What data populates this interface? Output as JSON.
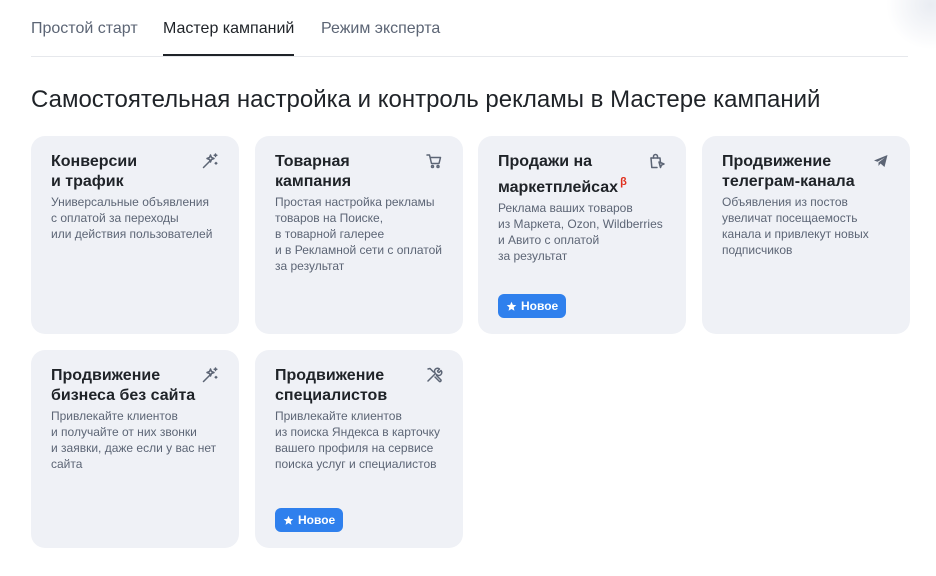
{
  "tabs": [
    {
      "label": "Простой старт",
      "active": false
    },
    {
      "label": "Мастер кампаний",
      "active": true
    },
    {
      "label": "Режим эксперта",
      "active": false
    }
  ],
  "page": {
    "title": "Самостоятельная настройка и контроль рекламы в Мастере кампаний"
  },
  "cards": [
    {
      "title_lines": [
        "Конверсии",
        "и трафик"
      ],
      "desc_lines": [
        "Универсальные объявления",
        "с оплатой за переходы",
        "или действия пользователей"
      ],
      "icon": "magic-wand-icon"
    },
    {
      "title_lines": [
        "Товарная",
        "кампания"
      ],
      "desc_lines": [
        "Простая настройка рекламы",
        "товаров на Поиске,",
        "в товарной галерее",
        "и в Рекламной сети с оплатой",
        "за результат"
      ],
      "icon": "cart-icon"
    },
    {
      "title_lines": [
        "Продажи на",
        "маркетплейсах"
      ],
      "beta": "β",
      "desc_lines": [
        "Реклама ваших товаров",
        "из Маркета, Ozon, Wildberries",
        "и Авито с оплатой",
        "за результат"
      ],
      "badge": "Новое",
      "icon": "shopping-bag-click-icon"
    },
    {
      "title_lines": [
        "Продвижение",
        "телеграм-канала"
      ],
      "desc_lines": [
        "Объявления из постов",
        "увеличат посещаемость",
        "канала и привлекут новых",
        "подписчиков"
      ],
      "icon": "telegram-plane-icon"
    },
    {
      "title_lines": [
        "Продвижение",
        "бизнеса без сайта"
      ],
      "desc_lines": [
        "Привлекайте клиентов",
        "и получайте от них звонки",
        "и заявки, даже если у вас нет",
        "сайта"
      ],
      "icon": "magic-wand-icon"
    },
    {
      "title_lines": [
        "Продвижение",
        "специалистов"
      ],
      "desc_lines": [
        "Привлекайте клиентов",
        "из поиска Яндекса в карточку",
        "вашего профиля на сервисе",
        "поиска услуг и специалистов"
      ],
      "badge": "Новое",
      "icon": "tools-icon"
    }
  ],
  "colors": {
    "card_bg": "#eff1f6",
    "badge_bg": "#2f80ed",
    "beta": "#e0301e",
    "text_primary": "#1f2328",
    "text_secondary": "#5c6575"
  }
}
